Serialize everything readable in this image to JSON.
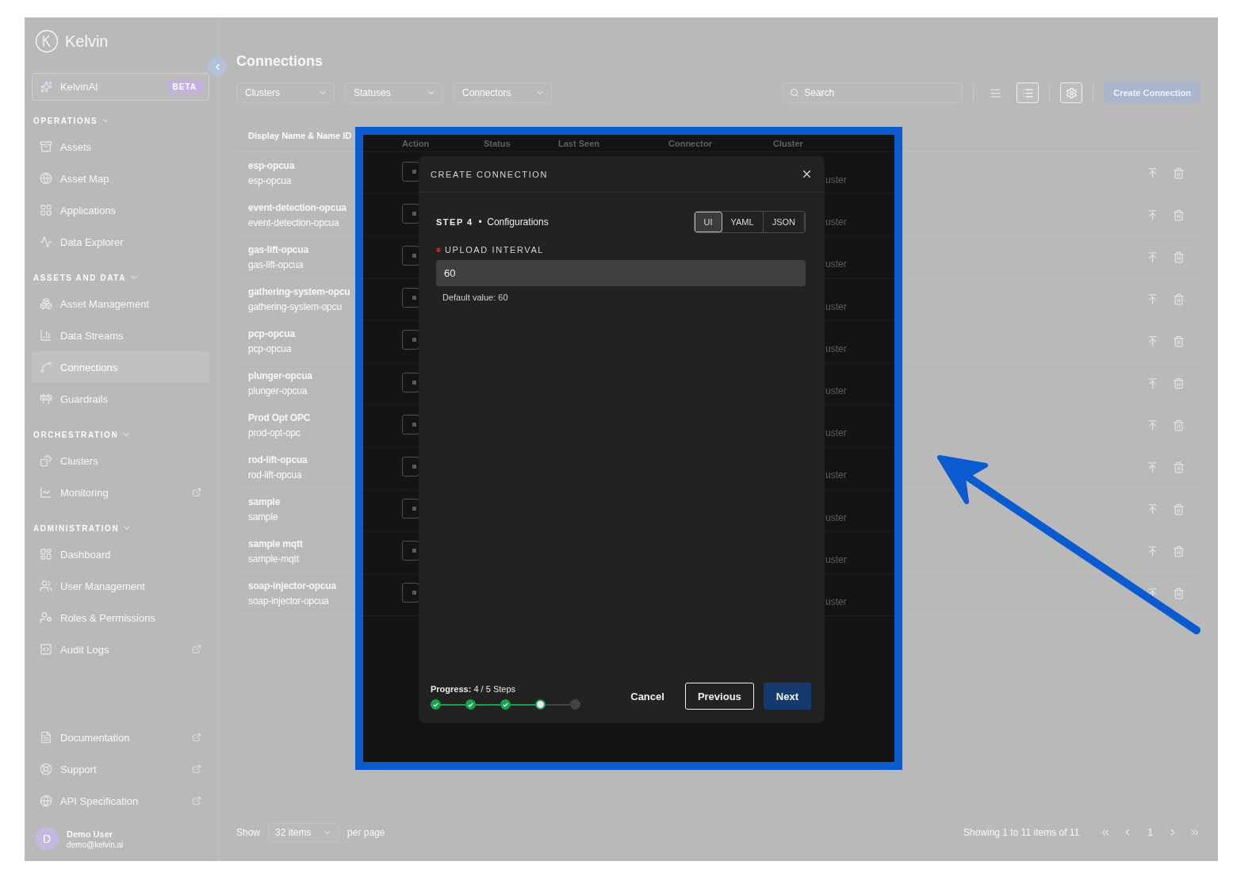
{
  "sidebar": {
    "logo": "Kelvin",
    "assistant": {
      "label": "KelvinAI",
      "badge": "BETA"
    },
    "sections": [
      {
        "title": "OPERATIONS",
        "expanded": true,
        "items": [
          {
            "label": "Assets",
            "selected": false,
            "external": false
          },
          {
            "label": "Asset Map",
            "selected": false,
            "external": false
          },
          {
            "label": "Applications",
            "selected": false,
            "external": false
          },
          {
            "label": "Data Explorer",
            "selected": false,
            "external": false
          }
        ]
      },
      {
        "title": "ASSETS AND DATA",
        "expanded": true,
        "items": [
          {
            "label": "Asset Management",
            "selected": false,
            "external": false
          },
          {
            "label": "Data Streams",
            "selected": false,
            "external": false
          },
          {
            "label": "Connections",
            "selected": true,
            "external": false
          },
          {
            "label": "Guardrails",
            "selected": false,
            "external": false
          }
        ]
      },
      {
        "title": "ORCHESTRATION",
        "expanded": true,
        "items": [
          {
            "label": "Clusters",
            "selected": false,
            "external": false
          },
          {
            "label": "Monitoring",
            "selected": false,
            "external": true
          }
        ]
      },
      {
        "title": "ADMINISTRATION",
        "expanded": true,
        "items": [
          {
            "label": "Dashboard",
            "selected": false,
            "external": false
          },
          {
            "label": "User Management",
            "selected": false,
            "external": false
          },
          {
            "label": "Roles & Permissions",
            "selected": false,
            "external": false
          },
          {
            "label": "Audit Logs",
            "selected": false,
            "external": true
          }
        ]
      }
    ],
    "links": [
      {
        "label": "Documentation",
        "external": true
      },
      {
        "label": "Support",
        "external": true
      },
      {
        "label": "API Specification",
        "external": true
      }
    ],
    "user": {
      "initial": "D",
      "name": "Demo User",
      "email": "demo@kelvin.ai"
    }
  },
  "header": {
    "title": "Connections",
    "filters": [
      {
        "label": "Clusters"
      },
      {
        "label": "Statuses"
      },
      {
        "label": "Connectors"
      }
    ],
    "search": {
      "placeholder": "Search"
    },
    "view_toggles": [
      {
        "selected": false
      },
      {
        "selected": true
      }
    ],
    "create_button": "Create Connection"
  },
  "table": {
    "columns": [
      "Display Name & Name ID",
      "Action",
      "Status",
      "Last Seen",
      "Connector",
      "Cluster"
    ],
    "rows": [
      {
        "name": "esp-opcua",
        "name_id": "esp-opcua",
        "cluster": "uster"
      },
      {
        "name": "event-detection-opcua",
        "name_id": "event-detection-opcua",
        "cluster": "uster"
      },
      {
        "name": "gas-lift-opcua",
        "name_id": "gas-lift-opcua",
        "cluster": "uster"
      },
      {
        "name": "gathering-system-opcu",
        "name_id": "gathering-system-opcu",
        "cluster": "uster"
      },
      {
        "name": "pcp-opcua",
        "name_id": "pcp-opcua",
        "cluster": "uster"
      },
      {
        "name": "plunger-opcua",
        "name_id": "plunger-opcua",
        "cluster": "uster"
      },
      {
        "name": "Prod Opt OPC",
        "name_id": "prod-opt-opc",
        "cluster": "uster"
      },
      {
        "name": "rod-lift-opcua",
        "name_id": "rod-lift-opcua",
        "cluster": "uster"
      },
      {
        "name": "sample",
        "name_id": "sample",
        "cluster": "uster"
      },
      {
        "name": "sample mqtt",
        "name_id": "sample-mqtt",
        "cluster": "uster"
      },
      {
        "name": "soap-injector-opcua",
        "name_id": "soap-injector-opcua",
        "cluster": "uster"
      }
    ]
  },
  "footer": {
    "show_label": "Show",
    "page_size": "32 items",
    "per_page_label": "per page",
    "summary": "Showing 1 to 11 items of 11",
    "current_page": "1"
  },
  "modal": {
    "title": "CREATE CONNECTION",
    "step_label": "STEP 4",
    "step_separator": "•",
    "step_name": "Configurations",
    "formats": [
      {
        "label": "UI",
        "selected": true
      },
      {
        "label": "YAML",
        "selected": false
      },
      {
        "label": "JSON",
        "selected": false
      }
    ],
    "field": {
      "label": "UPLOAD INTERVAL",
      "required": true,
      "value": "60",
      "hint": "Default value: 60"
    },
    "progress": {
      "label": "Progress:",
      "value": "4 / 5 Steps",
      "steps": [
        {
          "kind": "done"
        },
        {
          "kind": "done"
        },
        {
          "kind": "done"
        },
        {
          "kind": "current"
        },
        {
          "kind": "pending"
        }
      ]
    },
    "buttons": {
      "cancel": "Cancel",
      "previous": "Previous",
      "next": "Next"
    }
  }
}
